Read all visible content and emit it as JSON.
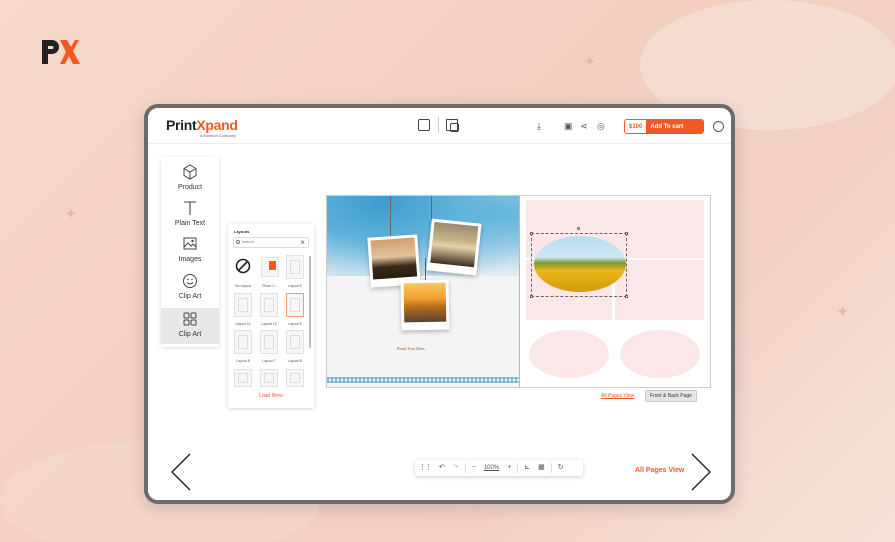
{
  "brand": {
    "logo_text": "PX",
    "name_part1": "Print",
    "name_part2": "Xpand",
    "subtitle": "A Kiintech Company"
  },
  "topbar": {
    "price": "$100",
    "add_to_cart": "Add To cart"
  },
  "tools": [
    {
      "label": "Product",
      "icon": "cube-icon"
    },
    {
      "label": "Plain Text",
      "icon": "text-icon"
    },
    {
      "label": "Images",
      "icon": "image-icon"
    },
    {
      "label": "Clip Art",
      "icon": "smiley-icon"
    },
    {
      "label": "Clip Art",
      "icon": "grid-layout-icon"
    }
  ],
  "layouts_panel": {
    "title": "Layouts",
    "search_placeholder": "search",
    "items": [
      {
        "caption": "No Layout"
      },
      {
        "caption": "Photo C..."
      },
      {
        "caption": "Layout 6"
      },
      {
        "caption": "Layout 11"
      },
      {
        "caption": "Layout 10"
      },
      {
        "caption": "Layout 5"
      },
      {
        "caption": "Layout 8"
      },
      {
        "caption": "Layout 7"
      },
      {
        "caption": "Layout 8"
      }
    ],
    "load_more": "Load More"
  },
  "canvas": {
    "left_logo_text": "Brush Your Ideas",
    "all_pages_link": "All Pages View",
    "front_back_button": "Front & Back Page"
  },
  "bottom": {
    "zoom_level": "100%",
    "all_pages_view": "All Pages View"
  },
  "colors": {
    "accent": "#f05a22",
    "background": "#f4d4c6",
    "frame": "#6b6b6b",
    "placeholder_pink": "#fbe7e7"
  }
}
